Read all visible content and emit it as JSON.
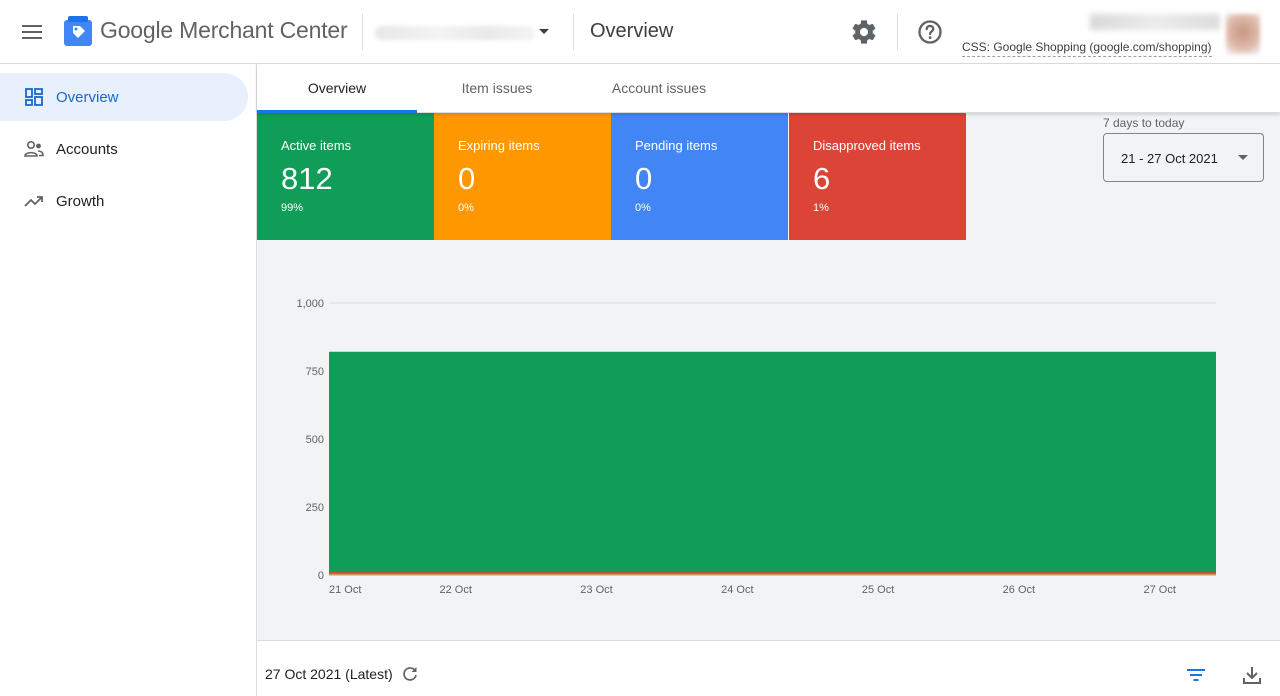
{
  "header": {
    "app_name": "Google Merchant Center",
    "page_title": "Overview",
    "css_link": "CSS: Google Shopping (google.com/shopping)",
    "icons": {
      "menu": "menu-icon",
      "logo": "merchant-center-logo-icon",
      "settings": "gear-icon",
      "help": "help-icon"
    }
  },
  "sidebar": {
    "items": [
      {
        "label": "Overview",
        "icon": "dashboard-icon",
        "active": true
      },
      {
        "label": "Accounts",
        "icon": "accounts-icon",
        "active": false
      },
      {
        "label": "Growth",
        "icon": "trending-up-icon",
        "active": false
      }
    ]
  },
  "tabs": [
    {
      "label": "Overview",
      "active": true
    },
    {
      "label": "Item issues",
      "active": false
    },
    {
      "label": "Account issues",
      "active": false
    }
  ],
  "cards": [
    {
      "label": "Active items",
      "value": "812",
      "percent": "99%",
      "color": "#0f9d58"
    },
    {
      "label": "Expiring items",
      "value": "0",
      "percent": "0%",
      "color": "#ff9800"
    },
    {
      "label": "Pending items",
      "value": "0",
      "percent": "0%",
      "color": "#4285f4"
    },
    {
      "label": "Disapproved items",
      "value": "6",
      "percent": "1%",
      "color": "#db4437"
    }
  ],
  "date_range": {
    "caption": "7 days to today",
    "value": "21 - 27 Oct 2021"
  },
  "chart_data": {
    "type": "area",
    "x": [
      "21 Oct",
      "22 Oct",
      "23 Oct",
      "24 Oct",
      "25 Oct",
      "26 Oct",
      "27 Oct"
    ],
    "x_tick_values": [
      0,
      0.9,
      1.9,
      2.9,
      3.9,
      4.9,
      5.9
    ],
    "x_range": [
      0,
      6.3
    ],
    "ylim": [
      0,
      1000
    ],
    "yticks": [
      0,
      250,
      500,
      750,
      1000
    ],
    "ytick_labels": [
      "0",
      "250",
      "500",
      "750",
      "1,000"
    ],
    "grid": true,
    "series": [
      {
        "values": [
          821,
          821,
          821,
          821,
          821,
          821,
          821
        ],
        "color": "#0f9d58"
      },
      {
        "values": [
          6,
          6,
          6,
          6,
          6,
          6,
          6
        ],
        "color": "#db4437"
      },
      {
        "values": [
          0,
          0,
          0,
          0,
          0,
          0,
          0
        ],
        "color": "#ff9800"
      }
    ]
  },
  "footer": {
    "date": "27 Oct 2021 (Latest)",
    "icons": {
      "refresh": "refresh-icon",
      "filter": "filter-icon",
      "download": "download-icon"
    }
  }
}
